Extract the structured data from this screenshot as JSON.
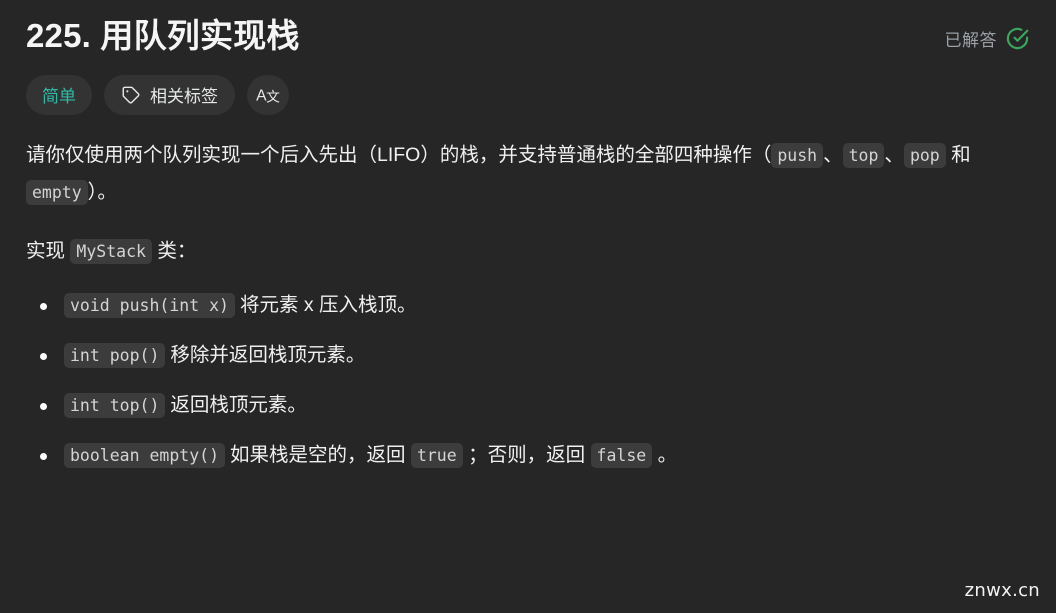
{
  "problem": {
    "title": "225. 用队列实现栈",
    "status_label": "已解答",
    "status_icon": "check-circle-icon",
    "status_color": "#3aa55d"
  },
  "tags": {
    "difficulty": {
      "label": "简单",
      "color": "#2cbba6"
    },
    "related_tags": {
      "label": "相关标签",
      "icon": "tag-icon"
    },
    "translate": {
      "icon": "translate-icon",
      "glyph_latin": "A",
      "glyph_cjk": "文"
    }
  },
  "description": {
    "paragraph1": {
      "part1": "请你仅使用两个队列实现一个后入先出（LIFO）的栈，并支持普通栈的全部四种操作（",
      "code1": "push",
      "sep1": "、",
      "code2": "top",
      "sep2": "、",
      "code3": "pop",
      "sep3": " 和 ",
      "code4": "empty",
      "part_end": "）。"
    },
    "paragraph2": {
      "prefix": "实现 ",
      "code": "MyStack",
      "suffix": " 类："
    },
    "operations": [
      {
        "signature": "void push(int x)",
        "desc": "将元素 x 压入栈顶。"
      },
      {
        "signature": "int pop()",
        "desc": "移除并返回栈顶元素。"
      },
      {
        "signature": "int top()",
        "desc": "返回栈顶元素。"
      },
      {
        "signature": "boolean empty()",
        "desc_part1": "如果栈是空的，返回 ",
        "code_true": "true",
        "desc_part2": " ；否则，返回 ",
        "code_false": "false",
        "desc_part3": " 。"
      }
    ]
  },
  "watermark": {
    "text": "znwx.cn"
  }
}
